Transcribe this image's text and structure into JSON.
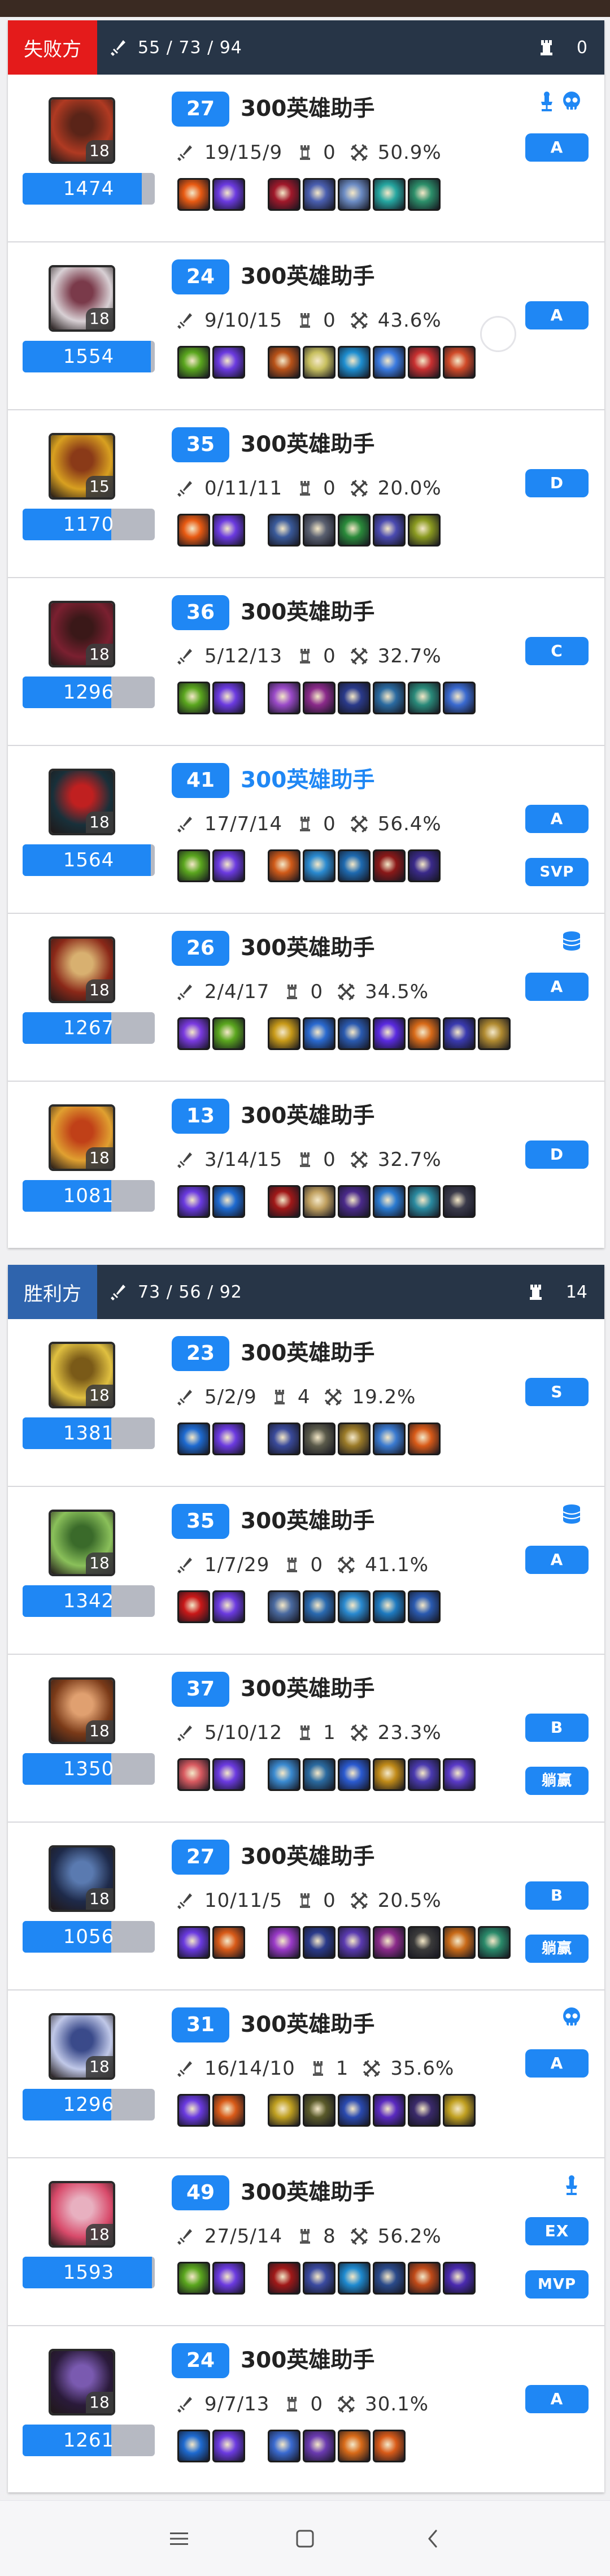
{
  "teams": [
    {
      "label": "失败方",
      "variant": "lose",
      "kda": "55 / 73 / 94",
      "towers": "0",
      "players": [
        {
          "hero_level": "27",
          "name": "300英雄助手",
          "level": "18",
          "rating": "1474",
          "rating_fill": 0.9,
          "kda": "19/15/9",
          "towers": "0",
          "participation": "50.9%",
          "grade": "A",
          "grade2": "",
          "badges": [
            "tower-badge-icon",
            "skull-badge-icon"
          ],
          "self": false,
          "radio": false,
          "items": [
            "#e85a12",
            "#6b3ae0",
            "#a0182a",
            "#4a5fb0",
            "#6c8cc4",
            "#25a6a0",
            "#2c8f6a"
          ],
          "avatar": [
            "#b03a22",
            "#5a2418"
          ]
        },
        {
          "hero_level": "24",
          "name": "300英雄助手",
          "level": "18",
          "rating": "1554",
          "rating_fill": 0.97,
          "kda": "9/10/15",
          "towers": "0",
          "participation": "43.6%",
          "grade": "A",
          "grade2": "",
          "badges": [],
          "self": false,
          "radio": true,
          "items": [
            "#5aa61e",
            "#6b3ae0",
            "#b85218",
            "#c8c060",
            "#1e8ed0",
            "#3a7ae0",
            "#c83030",
            "#d04a28"
          ],
          "avatar": [
            "#d8d0d4",
            "#7a3a4a"
          ]
        },
        {
          "hero_level": "35",
          "name": "300英雄助手",
          "level": "15",
          "rating": "1170",
          "rating_fill": 0.67,
          "kda": "0/11/11",
          "towers": "0",
          "participation": "20.0%",
          "grade": "D",
          "grade2": "",
          "badges": [],
          "self": false,
          "radio": false,
          "items": [
            "#e85a12",
            "#6b3ae0",
            "#3a5a9a",
            "#5a6070",
            "#2a8a3a",
            "#4a4ab0",
            "#8a9a20"
          ],
          "avatar": [
            "#d8a020",
            "#8a3a18"
          ]
        },
        {
          "hero_level": "36",
          "name": "300英雄助手",
          "level": "18",
          "rating": "1296",
          "rating_fill": 0.67,
          "kda": "5/12/13",
          "towers": "0",
          "participation": "32.7%",
          "grade": "C",
          "grade2": "",
          "badges": [],
          "self": false,
          "radio": false,
          "items": [
            "#5aa61e",
            "#6b3ae0",
            "#9a4ac8",
            "#8a2a8a",
            "#2a3a8a",
            "#2a6aa0",
            "#2a8a7a",
            "#3a6ad0"
          ],
          "avatar": [
            "#7a2030",
            "#3a1818"
          ]
        },
        {
          "hero_level": "41",
          "name": "300英雄助手",
          "level": "18",
          "rating": "1564",
          "rating_fill": 0.97,
          "kda": "17/7/14",
          "towers": "0",
          "participation": "56.4%",
          "grade": "A",
          "grade2": "SVP",
          "badges": [],
          "self": true,
          "radio": false,
          "items": [
            "#5aa61e",
            "#6b3ae0",
            "#d05a18",
            "#2a8ad0",
            "#1e6ab0",
            "#8a1818",
            "#3a2a8a"
          ],
          "avatar": [
            "#18303a",
            "#c02020"
          ]
        },
        {
          "hero_level": "26",
          "name": "300英雄助手",
          "level": "18",
          "rating": "1267",
          "rating_fill": 0.67,
          "kda": "2/4/17",
          "towers": "0",
          "participation": "34.5%",
          "grade": "A",
          "grade2": "",
          "badges": [
            "cylinder-badge-icon"
          ],
          "self": false,
          "radio": false,
          "items": [
            "#7a3ae0",
            "#5aa61e",
            "#c89a18",
            "#2a6ad0",
            "#2a5ab0",
            "#5a2ae0",
            "#d86a18",
            "#3a3ab0",
            "#b08a30"
          ],
          "avatar": [
            "#8a2818",
            "#d8b070"
          ]
        },
        {
          "hero_level": "13",
          "name": "300英雄助手",
          "level": "18",
          "rating": "1081",
          "rating_fill": 0.67,
          "kda": "3/14/15",
          "towers": "0",
          "participation": "32.7%",
          "grade": "D",
          "grade2": "",
          "badges": [],
          "self": false,
          "radio": false,
          "items": [
            "#6a3ae0",
            "#1e6ad0",
            "#a01818",
            "#c0a060",
            "#4a2a8a",
            "#2a7ad0",
            "#2a8aa0",
            "#3a3a4a"
          ],
          "avatar": [
            "#e0a030",
            "#c04018"
          ]
        }
      ]
    },
    {
      "label": "胜利方",
      "variant": "win",
      "kda": "73 / 56 / 92",
      "towers": "14",
      "players": [
        {
          "hero_level": "23",
          "name": "300英雄助手",
          "level": "18",
          "rating": "1381",
          "rating_fill": 0.67,
          "kda": "5/2/9",
          "towers": "4",
          "participation": "19.2%",
          "grade": "S",
          "grade2": "",
          "badges": [],
          "self": false,
          "radio": false,
          "items": [
            "#1e6ad0",
            "#6b3ae0",
            "#3a4a9a",
            "#5a5a4a",
            "#9a7a28",
            "#3a7ad0",
            "#d85a18"
          ],
          "avatar": [
            "#e0c040",
            "#7a5a18"
          ]
        },
        {
          "hero_level": "35",
          "name": "300英雄助手",
          "level": "18",
          "rating": "1342",
          "rating_fill": 0.67,
          "kda": "1/7/29",
          "towers": "0",
          "participation": "41.1%",
          "grade": "A",
          "grade2": "",
          "badges": [
            "cylinder-badge-icon"
          ],
          "self": false,
          "radio": false,
          "items": [
            "#c81818",
            "#6b3ae0",
            "#4a6aa0",
            "#2a6ab0",
            "#2a8ad0",
            "#1e7ac0",
            "#2a5ab0"
          ],
          "avatar": [
            "#8ac05a",
            "#3a6a2a"
          ]
        },
        {
          "hero_level": "37",
          "name": "300英雄助手",
          "level": "18",
          "rating": "1350",
          "rating_fill": 0.67,
          "kda": "5/10/12",
          "towers": "1",
          "participation": "23.3%",
          "grade": "B",
          "grade2": "躺赢",
          "badges": [],
          "self": false,
          "radio": false,
          "items": [
            "#d85a60",
            "#6b3ae0",
            "#3a8ad0",
            "#2a6aa0",
            "#2a5ad0",
            "#c08a18",
            "#4a3ab0",
            "#5a3ac8"
          ],
          "avatar": [
            "#7a3a18",
            "#e0a070"
          ]
        },
        {
          "hero_level": "27",
          "name": "300英雄助手",
          "level": "18",
          "rating": "1056",
          "rating_fill": 0.67,
          "kda": "10/11/5",
          "towers": "0",
          "participation": "20.5%",
          "grade": "B",
          "grade2": "躺赢",
          "badges": [],
          "self": false,
          "radio": false,
          "items": [
            "#6a3ae0",
            "#d85a18",
            "#9a3ac8",
            "#2a3a8a",
            "#5a3ab0",
            "#8a2a8a",
            "#3a3a3a",
            "#c86a18",
            "#2a8a6a"
          ],
          "avatar": [
            "#1e2a4a",
            "#5a7ab0"
          ]
        },
        {
          "hero_level": "31",
          "name": "300英雄助手",
          "level": "18",
          "rating": "1296",
          "rating_fill": 0.67,
          "kda": "16/14/10",
          "towers": "1",
          "participation": "35.6%",
          "grade": "A",
          "grade2": "",
          "badges": [
            "skull-badge-icon"
          ],
          "self": false,
          "radio": false,
          "items": [
            "#6a3ae0",
            "#d85a18",
            "#c0a020",
            "#5a5a2a",
            "#2a4ab0",
            "#5a2ac0",
            "#3a2a6a",
            "#c0a020"
          ],
          "avatar": [
            "#c0c8e8",
            "#3a4a8a"
          ]
        },
        {
          "hero_level": "49",
          "name": "300英雄助手",
          "level": "18",
          "rating": "1593",
          "rating_fill": 0.98,
          "kda": "27/5/14",
          "towers": "8",
          "participation": "56.2%",
          "grade": "EX",
          "grade2": "MVP",
          "badges": [
            "tower-badge-icon"
          ],
          "self": false,
          "radio": false,
          "items": [
            "#5aa61e",
            "#6b3ae0",
            "#a01818",
            "#3a4aa0",
            "#1e8ad0",
            "#2a4a8a",
            "#c04a18",
            "#4a2ab0"
          ],
          "avatar": [
            "#d84a6a",
            "#e8b0c0"
          ]
        },
        {
          "hero_level": "24",
          "name": "300英雄助手",
          "level": "18",
          "rating": "1261",
          "rating_fill": 0.67,
          "kda": "9/7/13",
          "towers": "0",
          "participation": "30.1%",
          "grade": "A",
          "grade2": "",
          "badges": [],
          "self": false,
          "radio": false,
          "items": [
            "#1e6ad0",
            "#6b3ae0",
            "#3a6ad0",
            "#6a3ab0",
            "#d86a18",
            "#d85a18"
          ],
          "avatar": [
            "#2a1a3a",
            "#7a5ab0"
          ]
        }
      ]
    }
  ],
  "nav": {
    "icons": [
      "menu-icon",
      "home-square-icon",
      "back-chevron-icon"
    ]
  },
  "colors": {
    "accent": "#1f87f4",
    "lose": "#e41b1b",
    "win": "#2f64ad",
    "header": "#273547"
  }
}
